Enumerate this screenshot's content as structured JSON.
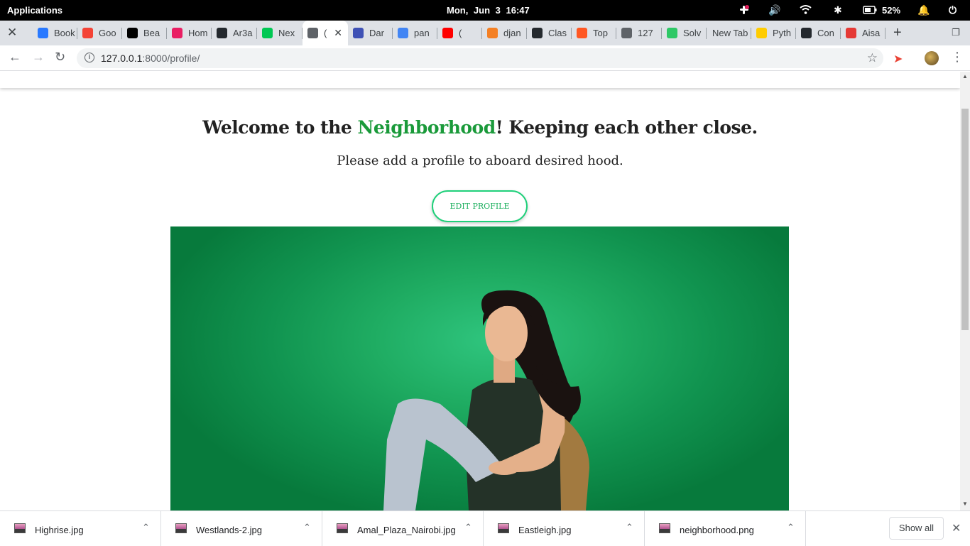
{
  "system_bar": {
    "applications": "Applications",
    "clock": "Mon, Jun  3   16:47",
    "battery": "52%"
  },
  "tabs": [
    {
      "title": "Book",
      "icon": "mdb-icon",
      "color": "#2979ff"
    },
    {
      "title": "Goo",
      "icon": "f-icon",
      "color": "#f44336"
    },
    {
      "title": "Bea",
      "icon": "unsplash-icon",
      "color": "#000000"
    },
    {
      "title": "Hom",
      "icon": "home-icon",
      "color": "#e91e63"
    },
    {
      "title": "Ar3a",
      "icon": "github-icon",
      "color": "#24292e"
    },
    {
      "title": "Nex",
      "icon": "nex-icon",
      "color": "#00c853"
    },
    {
      "title": "(",
      "icon": "globe-icon",
      "color": "#5f6368",
      "active": true
    },
    {
      "title": "Dar",
      "icon": "hexagon-icon",
      "color": "#3f51b5"
    },
    {
      "title": "pan",
      "icon": "google-icon",
      "color": "#4285f4"
    },
    {
      "title": "(",
      "icon": "youtube-icon",
      "color": "#ff0000"
    },
    {
      "title": "djan",
      "icon": "stackoverflow-icon",
      "color": "#f48024"
    },
    {
      "title": "Clas",
      "icon": "github-icon",
      "color": "#24292e"
    },
    {
      "title": "Top",
      "icon": "top-icon",
      "color": "#ff5722"
    },
    {
      "title": "127",
      "icon": "globe-icon",
      "color": "#5f6368"
    },
    {
      "title": "Solv",
      "icon": "hackerrank-icon",
      "color": "#2ec866"
    },
    {
      "title": "New Tab",
      "icon": "",
      "color": "#5f6368"
    },
    {
      "title": "Pyth",
      "icon": "python-icon",
      "color": "#ffcc00"
    },
    {
      "title": "Con",
      "icon": "circle-icon",
      "color": "#24292e"
    },
    {
      "title": "Aisa",
      "icon": "swirl-icon",
      "color": "#e53935"
    }
  ],
  "address_bar": {
    "host": "127.0.0.1",
    "path": ":8000/profile/"
  },
  "page": {
    "headline_before": "Welcome to the ",
    "headline_highlight": "Neighborhood",
    "headline_after": "! Keeping each other close.",
    "subline": "Please add a profile to aboard desired hood.",
    "edit_button": "EDIT PROFILE",
    "accent_color": "#1a9a3a"
  },
  "downloads": {
    "items": [
      "Highrise.jpg",
      "Westlands-2.jpg",
      "Amal_Plaza_Nairobi.jpg",
      "Eastleigh.jpg",
      "neighborhood.png"
    ],
    "show_all": "Show all"
  }
}
